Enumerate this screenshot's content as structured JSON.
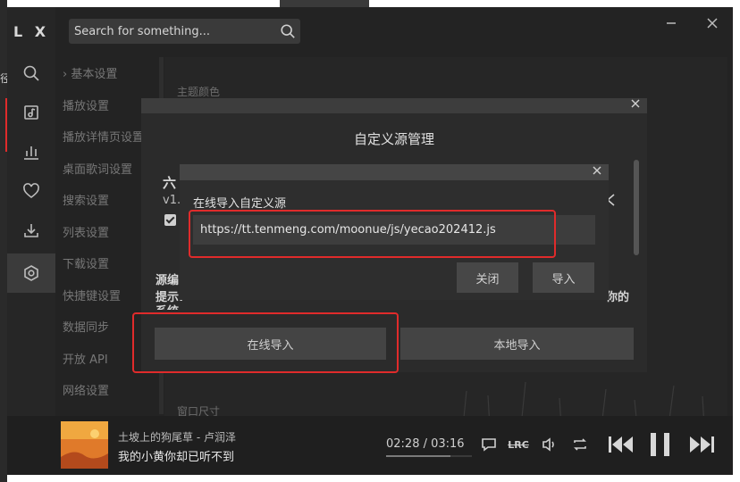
{
  "background": {
    "left_text": "径"
  },
  "app": {
    "logo": "L X",
    "search": {
      "placeholder": "Search for something..."
    },
    "rail": [
      {
        "name": "search",
        "icon": "search-icon"
      },
      {
        "name": "music-list",
        "icon": "music-list-icon"
      },
      {
        "name": "leaderboard",
        "icon": "chart-icon"
      },
      {
        "name": "favorites",
        "icon": "heart-icon"
      },
      {
        "name": "downloads",
        "icon": "download-icon"
      },
      {
        "name": "settings",
        "icon": "gear-icon",
        "active": true
      }
    ],
    "settings_menu": [
      {
        "label": "基本设置",
        "arrow": "›"
      },
      {
        "label": "播放设置"
      },
      {
        "label": "播放详情页设置"
      },
      {
        "label": "桌面歌词设置"
      },
      {
        "label": "搜索设置"
      },
      {
        "label": "列表设置"
      },
      {
        "label": "下载设置"
      },
      {
        "label": "快捷键设置"
      },
      {
        "label": "数据同步"
      },
      {
        "label": "开放 API"
      },
      {
        "label": "网络设置"
      }
    ],
    "content": {
      "theme_label": "主题颜色",
      "window_size_label": "窗口尺寸"
    }
  },
  "player": {
    "artist_line": "土坡上的狗尾草 - 卢润泽",
    "lyric_line": "我的小黄你却已听不到",
    "time": "02:28 / 03:16",
    "progress": 0.755,
    "lrc_label": "LRC"
  },
  "modal": {
    "title": "自定义源管理",
    "partial_title": "六",
    "partial_version": "v1.",
    "partial_source": "源编",
    "partial_tip": "提示:",
    "partial_system": "系统",
    "partial_right": "你的",
    "online_import": "在线导入",
    "local_import": "本地导入"
  },
  "dialog": {
    "label": "在线导入自定义源",
    "input_value": "https://tt.tenmeng.com/moonue/js/yecao202412.js",
    "close_label": "关闭",
    "import_label": "导入"
  },
  "colors": {
    "app_bg": "#232323",
    "highlight": "#e02b2b"
  }
}
